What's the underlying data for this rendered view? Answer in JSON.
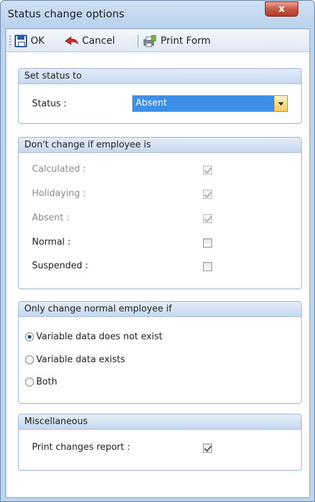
{
  "window": {
    "title": "Status change options",
    "close_glyph": "x"
  },
  "toolbar": {
    "ok_label": "OK",
    "cancel_label": "Cancel",
    "print_label": "Print Form",
    "icons": {
      "ok": "save-icon",
      "cancel": "undo-arrow-icon",
      "print": "print-form-icon"
    }
  },
  "set_status": {
    "header": "Set status to",
    "status_label": "Status :",
    "status_value": "Absent"
  },
  "dont_change": {
    "header": "Don't change if employee is",
    "items": [
      {
        "label": "Calculated :",
        "checked": true,
        "enabled": false
      },
      {
        "label": "Holidaying :",
        "checked": true,
        "enabled": false
      },
      {
        "label": "Absent :",
        "checked": true,
        "enabled": false
      },
      {
        "label": "Normal :",
        "checked": false,
        "enabled": true
      },
      {
        "label": "Suspended :",
        "checked": false,
        "enabled": true
      }
    ]
  },
  "only_change": {
    "header": "Only change normal employee if",
    "options": [
      {
        "label": "Variable data does not exist",
        "selected": true
      },
      {
        "label": "Variable data exists",
        "selected": false
      },
      {
        "label": "Both",
        "selected": false
      }
    ]
  },
  "misc": {
    "header": "Miscellaneous",
    "print_report_label": "Print changes report :",
    "print_report_checked": true
  },
  "colors": {
    "selection": "#3d8ee6",
    "frame": "#bcd5ef",
    "close": "#c85a47"
  }
}
